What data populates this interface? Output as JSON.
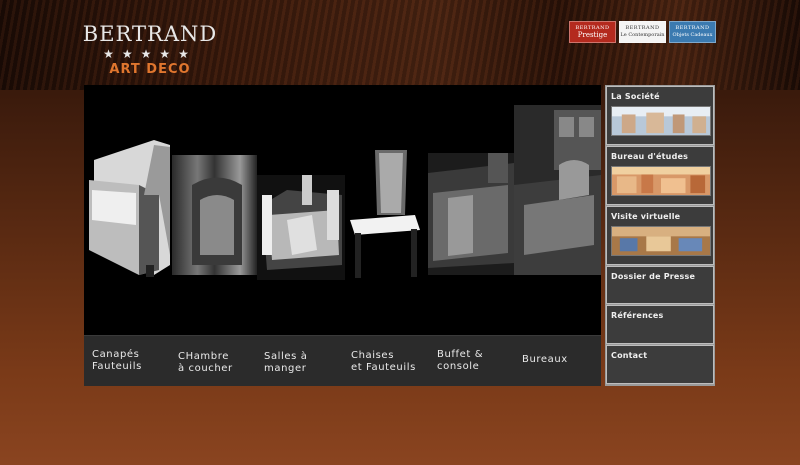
{
  "logo": {
    "name": "BERTRAND",
    "stars": "★★★★★",
    "subtitle": "ART DECO"
  },
  "brands": [
    {
      "line1": "BERTRAND",
      "line2": "Prestige"
    },
    {
      "line1": "BERTRAND",
      "line2": "Le Contemporain"
    },
    {
      "line1": "BERTRAND",
      "line2": "Objets Cadeaux"
    }
  ],
  "categories": [
    {
      "label": "Canapés\nFauteuils"
    },
    {
      "label": "CHambre\nà coucher"
    },
    {
      "label": "Salles à\nmanger"
    },
    {
      "label": "Chaises\net Fauteuils"
    },
    {
      "label": "Buffet &\nconsole"
    },
    {
      "label": "Bureaux"
    }
  ],
  "sidebar": [
    {
      "label": "La Société"
    },
    {
      "label": "Bureau d'études"
    },
    {
      "label": "Visite virtuelle"
    },
    {
      "label": "Dossier de Presse"
    },
    {
      "label": "Références"
    },
    {
      "label": "Contact"
    }
  ],
  "colors": {
    "accent": "#e0762e",
    "prestige": "#b42a1e",
    "cadeaux": "#3b7ab0",
    "category_bar": "#2b2b2b",
    "sidebar_item": "#3c3c3c"
  }
}
